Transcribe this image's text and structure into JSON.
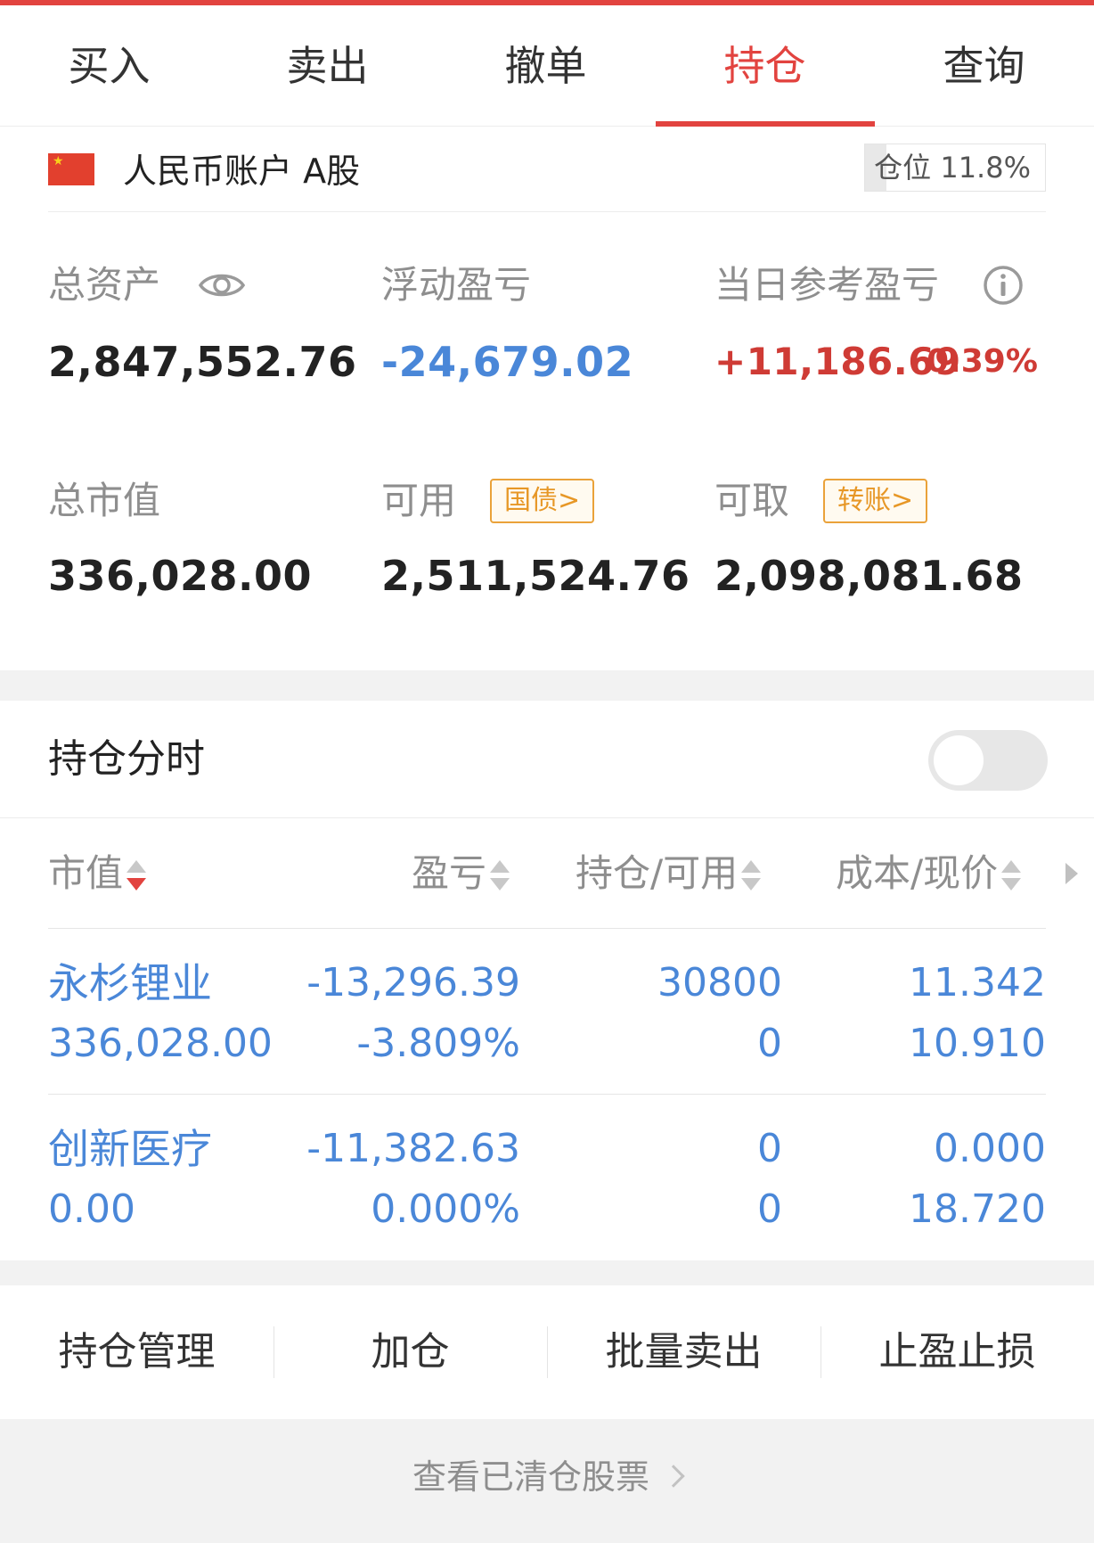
{
  "tabs": [
    {
      "label": "买入"
    },
    {
      "label": "卖出"
    },
    {
      "label": "撤单"
    },
    {
      "label": "持仓",
      "active": true
    },
    {
      "label": "查询"
    }
  ],
  "account": {
    "name": "人民币账户 A股",
    "position_label": "仓位 11.8%",
    "position_ratio": 0.118
  },
  "stats": {
    "total_assets": {
      "label": "总资产",
      "value": "2,847,552.76"
    },
    "floating_pnl": {
      "label": "浮动盈亏",
      "value": "-24,679.02"
    },
    "daily_pnl": {
      "label": "当日参考盈亏",
      "value": "+11,186.69",
      "pct": "0.39%"
    },
    "market_value": {
      "label": "总市值",
      "value": "336,028.00"
    },
    "available": {
      "label": "可用",
      "value": "2,511,524.76",
      "tag": "国债>"
    },
    "withdrawable": {
      "label": "可取",
      "value": "2,098,081.68",
      "tag": "转账>"
    }
  },
  "holdings_section": {
    "title": "持仓分时",
    "toggle_on": false
  },
  "table": {
    "headers": [
      "市值",
      "盈亏",
      "持仓/可用",
      "成本/现价"
    ],
    "rows": [
      {
        "name": "永杉锂业",
        "market_value": "336,028.00",
        "pnl": "-13,296.39",
        "pnl_pct": "-3.809%",
        "holding": "30800",
        "available": "0",
        "cost": "11.342",
        "price": "10.910"
      },
      {
        "name": "创新医疗",
        "market_value": "0.00",
        "pnl": "-11,382.63",
        "pnl_pct": "0.000%",
        "holding": "0",
        "available": "0",
        "cost": "0.000",
        "price": "18.720"
      }
    ]
  },
  "actions": [
    "持仓管理",
    "加仓",
    "批量卖出",
    "止盈止损"
  ],
  "footer": {
    "link": "查看已清仓股票"
  },
  "colors": {
    "accent": "#e2433f",
    "blue": "#4a87d8",
    "red": "#cf3b35",
    "tag": "#eaa23a"
  }
}
